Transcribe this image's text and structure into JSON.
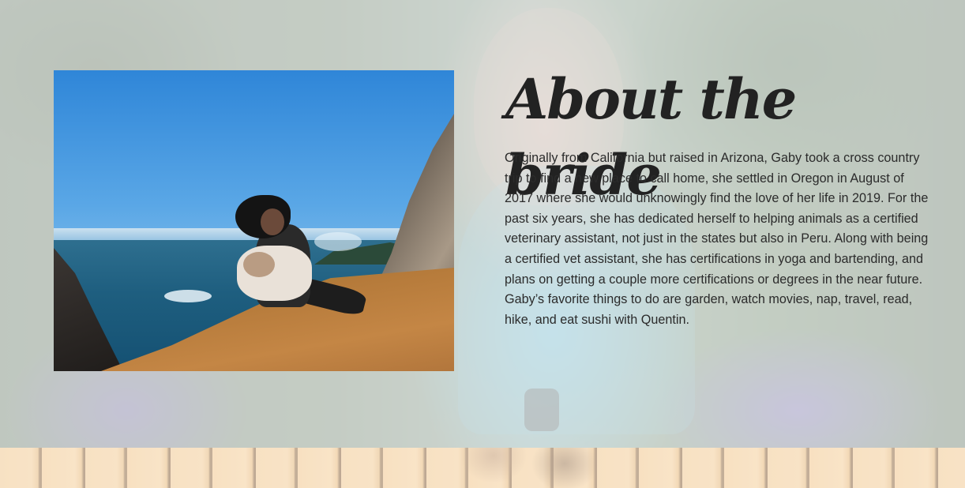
{
  "about": {
    "heading": "About the bride",
    "body": "Originally from California but raised in Arizona, Gaby took a cross country trip to find a new place to call home, she settled in Oregon in August of 2017 where she would unknowingly find the love of her life in 2019. For the past six years, she has dedicated herself to helping animals as a certified veterinary assistant, not just in the states but also in Peru. Along with being a certified vet assistant, she has certifications in yoga and bartending, and plans on getting a couple more certifications or degrees in the near future. Gaby’s favorite things to do are garden, watch movies, nap, travel, read, hike, and eat sushi with Quentin."
  },
  "colors": {
    "overlay": "#ececec",
    "heading": "#222222",
    "body_text": "#2b2b2b"
  }
}
